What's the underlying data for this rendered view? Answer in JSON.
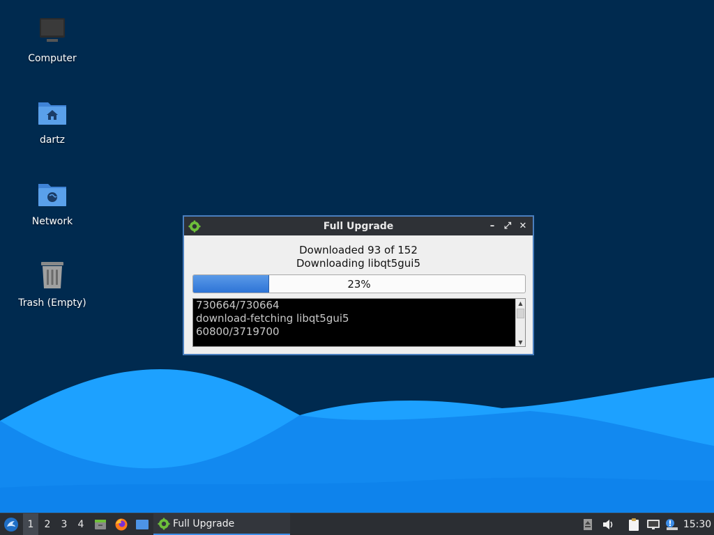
{
  "desktop": {
    "icons": [
      {
        "name": "computer-icon",
        "label": "Computer"
      },
      {
        "name": "home-folder-icon",
        "label": "dartz"
      },
      {
        "name": "network-folder-icon",
        "label": "Network"
      },
      {
        "name": "trash-icon",
        "label": "Trash (Empty)"
      }
    ]
  },
  "dialog": {
    "title": "Full Upgrade",
    "status_line1": "Downloaded 93 of 152",
    "status_line2": "Downloading libqt5gui5",
    "progress_percent": 23,
    "progress_label": "23%",
    "log": [
      "730664/730664",
      "download-fetching libqt5gui5",
      "60800/3719700"
    ],
    "controls": {
      "minimize": "–",
      "maximize": "⤢",
      "close": "✕"
    }
  },
  "taskbar": {
    "workspaces": [
      "1",
      "2",
      "3",
      "4"
    ],
    "active_workspace": "1",
    "launchers": [
      "file-manager-icon",
      "firefox-icon",
      "desktop-icon"
    ],
    "task": {
      "label": "Full Upgrade",
      "icon": "gear-icon"
    },
    "tray": [
      "updates-icon",
      "volume-icon",
      "clipboard-icon",
      "network-icon",
      "notification-icon"
    ],
    "clock": "15:30"
  },
  "colors": {
    "desktop_bg": "#002a4f",
    "wave_light": "#1da1ff",
    "wave_dark": "#0a6fd6",
    "progress": "#2e74d6",
    "taskbar": "#2b2e33"
  }
}
